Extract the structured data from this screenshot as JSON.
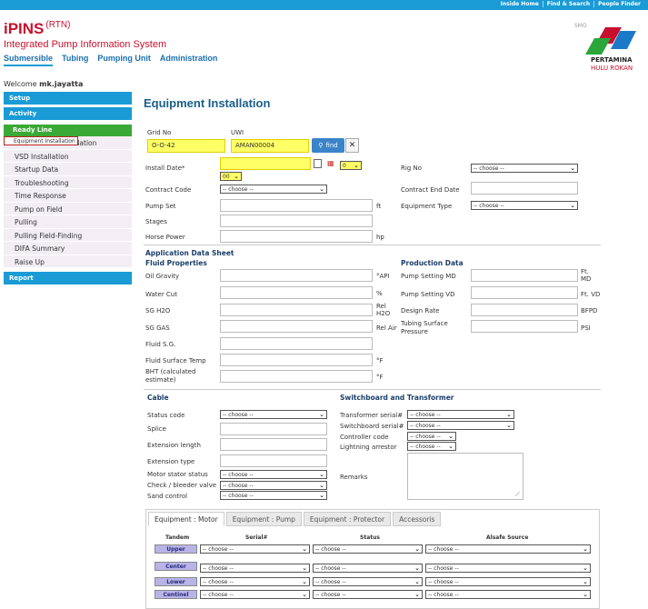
{
  "top_links": [
    "Inside Home",
    "Find & Search",
    "People Finder"
  ],
  "brand": {
    "name": "iPINS",
    "tag": "(RTN)",
    "subtitle": "Integrated Pump Information System"
  },
  "nav": [
    "Submersible",
    "Tubing",
    "Pumping Unit",
    "Administration"
  ],
  "logo": {
    "smo": "SMO",
    "line1": "PERTAMINA",
    "line2": "HULU ROKAN"
  },
  "welcome": {
    "prefix": "Welcome ",
    "user": "mk.jayatta"
  },
  "sidebar": {
    "setup": "Setup",
    "activity": "Activity",
    "ready_line": "Ready Line",
    "items": [
      "Equipment Installation",
      "Switchboard Installation",
      "VSD Installation",
      "Startup Data",
      "Troubleshooting",
      "Time Response",
      "Pump on Field",
      "Pulling",
      "Pulling Field-Finding",
      "DIFA Summary",
      "Raise Up"
    ],
    "report": "Report"
  },
  "page_title": "Equipment Installation",
  "form": {
    "grid_no_label": "Grid No",
    "grid_no": "O-O-42",
    "uwi_label": "UWI",
    "uwi": "AMAN00004",
    "find": "find",
    "install_date_label": "Install Date*",
    "hour": "0",
    "minute": "00",
    "rig_no_label": "Rig No",
    "choose": "-- choose --",
    "contract_code_label": "Contract Code",
    "contract_end_label": "Contract End Date",
    "pump_set_label": "Pump Set",
    "ft": "ft",
    "equipment_type_label": "Equipment Type",
    "stages_label": "Stages",
    "horse_power_label": "Horse Power",
    "hp": "hp"
  },
  "ads": {
    "title": "Application Data Sheet",
    "fluid_title": "Fluid Properties",
    "production_title": "Production Data",
    "oil_gravity": "Oil Gravity",
    "api": "°API",
    "water_cut": "Water Cut",
    "pct": "%",
    "sg_h2o": "SG H2O",
    "rel_h2o": "Rel H2O",
    "sg_gas": "SG GAS",
    "rel_air": "Rel Air",
    "fluid_sg": "Fluid S.G.",
    "fluid_surface_temp": "Fluid Surface Temp",
    "degf": "°F",
    "bht": "BHT (calculated estimate)",
    "degf2": "°F",
    "pump_setting_md": "Pump Setting MD",
    "ft_md": "Ft. MD",
    "pump_setting_vd": "Pump Setting VD",
    "ft_vd": "Ft. VD",
    "design_rate": "Design Rate",
    "bfpd": "BFPD",
    "tubing_surface_pressure": "Tubing Surface Pressure",
    "psi": "PSI"
  },
  "cable": {
    "title": "Cable",
    "status_code": "Status code",
    "splice": "Splice",
    "extension_length": "Extension length",
    "extension_type": "Extension type",
    "motor_stator_status": "Motor stator status",
    "check_bleeder_valve": "Check / bleeder valve",
    "sand_control": "Sand control"
  },
  "switchboard": {
    "title": "Switchboard and Transformer",
    "transformer_serial": "Transformer serial#",
    "switchboard_serial": "Switchboard serial#",
    "controller_code": "Controller code",
    "lightning_arrestor": "Lightning arrestor",
    "remarks": "Remarks"
  },
  "tabs": [
    "Equipment : Motor",
    "Equipment : Pump",
    "Equipment : Protector",
    "Accessoris"
  ],
  "motor_table": {
    "headers": [
      "Tandem",
      "Serial#",
      "Status",
      "Alsafe Source"
    ],
    "rows": [
      "Upper",
      "Center",
      "Lower",
      "Centinel"
    ]
  }
}
